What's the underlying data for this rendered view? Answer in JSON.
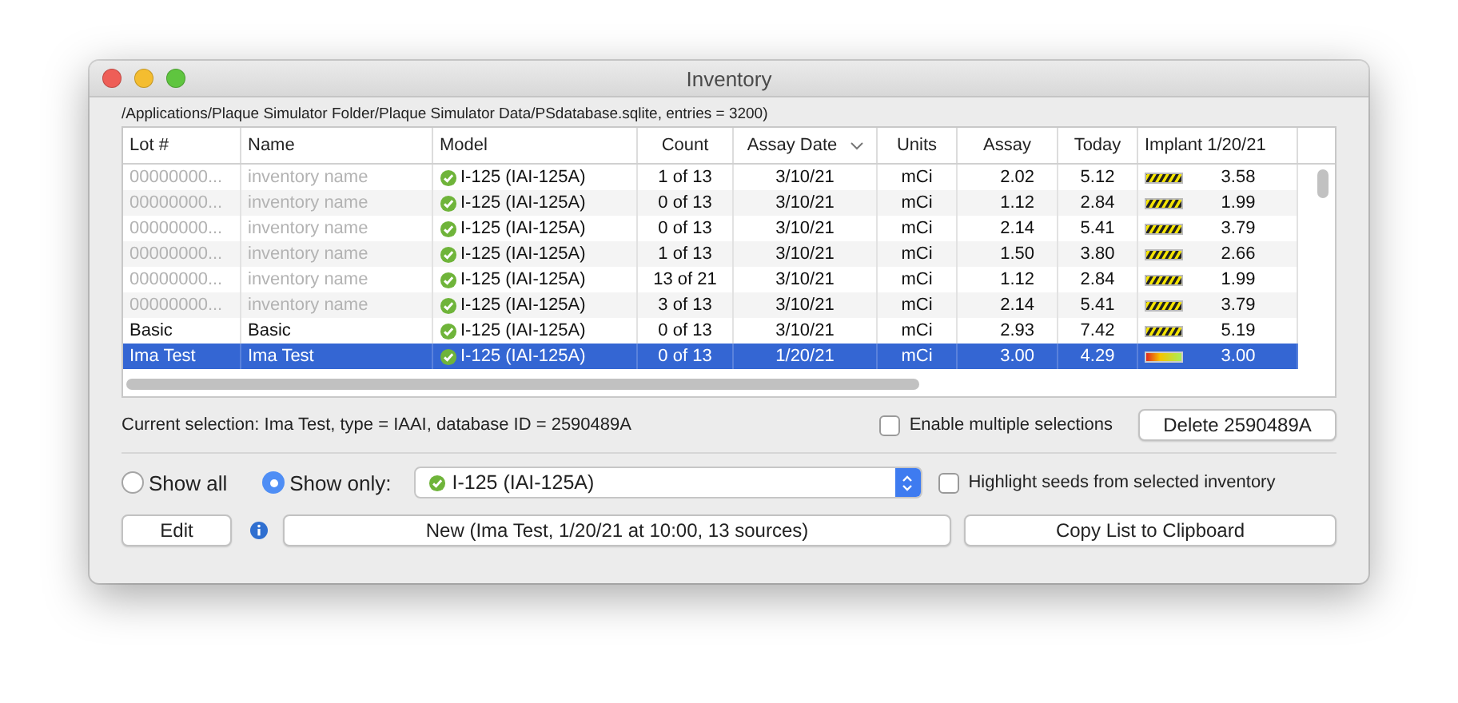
{
  "window": {
    "title": "Inventory"
  },
  "path": "/Applications/Plaque Simulator Folder/Plaque Simulator Data/PSdatabase.sqlite, entries = 3200)",
  "table": {
    "columns": [
      {
        "label": "Lot #",
        "sorted": false
      },
      {
        "label": "Name",
        "sorted": false
      },
      {
        "label": "Model",
        "sorted": false
      },
      {
        "label": "Count",
        "sorted": false
      },
      {
        "label": "Assay Date",
        "sorted": true
      },
      {
        "label": "Units",
        "sorted": false
      },
      {
        "label": "Assay",
        "sorted": false
      },
      {
        "label": "Today",
        "sorted": false
      },
      {
        "label": "Implant 1/20/21",
        "sorted": false
      }
    ],
    "rows": [
      {
        "lot": "00000000...",
        "name": "inventory name",
        "model": "I-125 (IAI-125A)",
        "count": "1 of 13",
        "assay_date": "3/10/21",
        "units": "mCi",
        "assay": "2.02",
        "today": "5.12",
        "kind": "striped",
        "implant": "3.58",
        "dimmed": true,
        "selected": false
      },
      {
        "lot": "00000000...",
        "name": "inventory name",
        "model": "I-125 (IAI-125A)",
        "count": "0 of 13",
        "assay_date": "3/10/21",
        "units": "mCi",
        "assay": "1.12",
        "today": "2.84",
        "kind": "striped",
        "implant": "1.99",
        "dimmed": true,
        "selected": false
      },
      {
        "lot": "00000000...",
        "name": "inventory name",
        "model": "I-125 (IAI-125A)",
        "count": "0 of 13",
        "assay_date": "3/10/21",
        "units": "mCi",
        "assay": "2.14",
        "today": "5.41",
        "kind": "striped",
        "implant": "3.79",
        "dimmed": true,
        "selected": false
      },
      {
        "lot": "00000000...",
        "name": "inventory name",
        "model": "I-125 (IAI-125A)",
        "count": "1 of 13",
        "assay_date": "3/10/21",
        "units": "mCi",
        "assay": "1.50",
        "today": "3.80",
        "kind": "striped",
        "implant": "2.66",
        "dimmed": true,
        "selected": false
      },
      {
        "lot": "00000000...",
        "name": "inventory name",
        "model": "I-125 (IAI-125A)",
        "count": "13 of 21",
        "assay_date": "3/10/21",
        "units": "mCi",
        "assay": "1.12",
        "today": "2.84",
        "kind": "striped",
        "implant": "1.99",
        "dimmed": true,
        "selected": false
      },
      {
        "lot": "00000000...",
        "name": "inventory name",
        "model": "I-125 (IAI-125A)",
        "count": "3 of 13",
        "assay_date": "3/10/21",
        "units": "mCi",
        "assay": "2.14",
        "today": "5.41",
        "kind": "striped",
        "implant": "3.79",
        "dimmed": true,
        "selected": false
      },
      {
        "lot": "Basic",
        "name": "Basic",
        "model": "I-125 (IAI-125A)",
        "count": "0 of 13",
        "assay_date": "3/10/21",
        "units": "mCi",
        "assay": "2.93",
        "today": "7.42",
        "kind": "striped",
        "implant": "5.19",
        "dimmed": false,
        "selected": false
      },
      {
        "lot": "Ima Test",
        "name": "Ima Test",
        "model": "I-125 (IAI-125A)",
        "count": "0 of 13",
        "assay_date": "1/20/21",
        "units": "mCi",
        "assay": "3.00",
        "today": "4.29",
        "kind": "gradient",
        "implant": "3.00",
        "dimmed": false,
        "selected": true
      }
    ]
  },
  "selection_info": "Current selection: Ima Test, type = IAAI, database ID = 2590489A",
  "multiple_selections": {
    "label": "Enable multiple selections",
    "checked": false
  },
  "delete_button": "Delete 2590489A",
  "filter": {
    "options": [
      {
        "label": "Show all",
        "selected": false
      },
      {
        "label": "Show only:",
        "selected": true
      }
    ],
    "dropdown": {
      "value": "I-125 (IAI-125A)"
    }
  },
  "highlight": {
    "label": "Highlight seeds from selected inventory",
    "checked": false
  },
  "buttons": {
    "edit": "Edit",
    "new": "New (Ima Test, 1/20/21 at 10:00, 13 sources)",
    "copy": "Copy List to Clipboard"
  }
}
